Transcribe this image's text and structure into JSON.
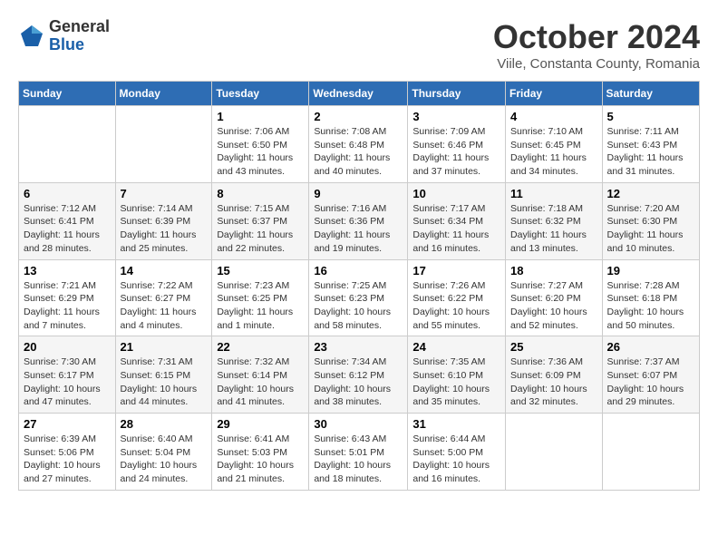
{
  "logo": {
    "general": "General",
    "blue": "Blue"
  },
  "title": "October 2024",
  "subtitle": "Viile, Constanta County, Romania",
  "days_of_week": [
    "Sunday",
    "Monday",
    "Tuesday",
    "Wednesday",
    "Thursday",
    "Friday",
    "Saturday"
  ],
  "weeks": [
    [
      {
        "day": "",
        "info": ""
      },
      {
        "day": "",
        "info": ""
      },
      {
        "day": "1",
        "info": "Sunrise: 7:06 AM\nSunset: 6:50 PM\nDaylight: 11 hours and 43 minutes."
      },
      {
        "day": "2",
        "info": "Sunrise: 7:08 AM\nSunset: 6:48 PM\nDaylight: 11 hours and 40 minutes."
      },
      {
        "day": "3",
        "info": "Sunrise: 7:09 AM\nSunset: 6:46 PM\nDaylight: 11 hours and 37 minutes."
      },
      {
        "day": "4",
        "info": "Sunrise: 7:10 AM\nSunset: 6:45 PM\nDaylight: 11 hours and 34 minutes."
      },
      {
        "day": "5",
        "info": "Sunrise: 7:11 AM\nSunset: 6:43 PM\nDaylight: 11 hours and 31 minutes."
      }
    ],
    [
      {
        "day": "6",
        "info": "Sunrise: 7:12 AM\nSunset: 6:41 PM\nDaylight: 11 hours and 28 minutes."
      },
      {
        "day": "7",
        "info": "Sunrise: 7:14 AM\nSunset: 6:39 PM\nDaylight: 11 hours and 25 minutes."
      },
      {
        "day": "8",
        "info": "Sunrise: 7:15 AM\nSunset: 6:37 PM\nDaylight: 11 hours and 22 minutes."
      },
      {
        "day": "9",
        "info": "Sunrise: 7:16 AM\nSunset: 6:36 PM\nDaylight: 11 hours and 19 minutes."
      },
      {
        "day": "10",
        "info": "Sunrise: 7:17 AM\nSunset: 6:34 PM\nDaylight: 11 hours and 16 minutes."
      },
      {
        "day": "11",
        "info": "Sunrise: 7:18 AM\nSunset: 6:32 PM\nDaylight: 11 hours and 13 minutes."
      },
      {
        "day": "12",
        "info": "Sunrise: 7:20 AM\nSunset: 6:30 PM\nDaylight: 11 hours and 10 minutes."
      }
    ],
    [
      {
        "day": "13",
        "info": "Sunrise: 7:21 AM\nSunset: 6:29 PM\nDaylight: 11 hours and 7 minutes."
      },
      {
        "day": "14",
        "info": "Sunrise: 7:22 AM\nSunset: 6:27 PM\nDaylight: 11 hours and 4 minutes."
      },
      {
        "day": "15",
        "info": "Sunrise: 7:23 AM\nSunset: 6:25 PM\nDaylight: 11 hours and 1 minute."
      },
      {
        "day": "16",
        "info": "Sunrise: 7:25 AM\nSunset: 6:23 PM\nDaylight: 10 hours and 58 minutes."
      },
      {
        "day": "17",
        "info": "Sunrise: 7:26 AM\nSunset: 6:22 PM\nDaylight: 10 hours and 55 minutes."
      },
      {
        "day": "18",
        "info": "Sunrise: 7:27 AM\nSunset: 6:20 PM\nDaylight: 10 hours and 52 minutes."
      },
      {
        "day": "19",
        "info": "Sunrise: 7:28 AM\nSunset: 6:18 PM\nDaylight: 10 hours and 50 minutes."
      }
    ],
    [
      {
        "day": "20",
        "info": "Sunrise: 7:30 AM\nSunset: 6:17 PM\nDaylight: 10 hours and 47 minutes."
      },
      {
        "day": "21",
        "info": "Sunrise: 7:31 AM\nSunset: 6:15 PM\nDaylight: 10 hours and 44 minutes."
      },
      {
        "day": "22",
        "info": "Sunrise: 7:32 AM\nSunset: 6:14 PM\nDaylight: 10 hours and 41 minutes."
      },
      {
        "day": "23",
        "info": "Sunrise: 7:34 AM\nSunset: 6:12 PM\nDaylight: 10 hours and 38 minutes."
      },
      {
        "day": "24",
        "info": "Sunrise: 7:35 AM\nSunset: 6:10 PM\nDaylight: 10 hours and 35 minutes."
      },
      {
        "day": "25",
        "info": "Sunrise: 7:36 AM\nSunset: 6:09 PM\nDaylight: 10 hours and 32 minutes."
      },
      {
        "day": "26",
        "info": "Sunrise: 7:37 AM\nSunset: 6:07 PM\nDaylight: 10 hours and 29 minutes."
      }
    ],
    [
      {
        "day": "27",
        "info": "Sunrise: 6:39 AM\nSunset: 5:06 PM\nDaylight: 10 hours and 27 minutes."
      },
      {
        "day": "28",
        "info": "Sunrise: 6:40 AM\nSunset: 5:04 PM\nDaylight: 10 hours and 24 minutes."
      },
      {
        "day": "29",
        "info": "Sunrise: 6:41 AM\nSunset: 5:03 PM\nDaylight: 10 hours and 21 minutes."
      },
      {
        "day": "30",
        "info": "Sunrise: 6:43 AM\nSunset: 5:01 PM\nDaylight: 10 hours and 18 minutes."
      },
      {
        "day": "31",
        "info": "Sunrise: 6:44 AM\nSunset: 5:00 PM\nDaylight: 10 hours and 16 minutes."
      },
      {
        "day": "",
        "info": ""
      },
      {
        "day": "",
        "info": ""
      }
    ]
  ]
}
